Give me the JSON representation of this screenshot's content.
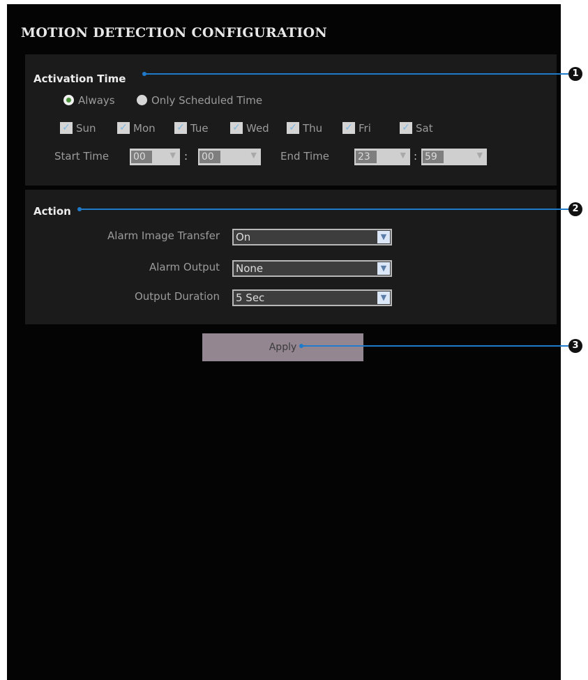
{
  "page_title": "MOTION DETECTION CONFIGURATION",
  "activation": {
    "title": "Activation Time",
    "radios": [
      {
        "label": "Always",
        "selected": true
      },
      {
        "label": "Only Scheduled Time",
        "selected": false
      }
    ],
    "days": [
      {
        "label": "Sun",
        "checked": true
      },
      {
        "label": "Mon",
        "checked": true
      },
      {
        "label": "Tue",
        "checked": true
      },
      {
        "label": "Wed",
        "checked": true
      },
      {
        "label": "Thu",
        "checked": true
      },
      {
        "label": "Fri",
        "checked": true
      },
      {
        "label": "Sat",
        "checked": true
      }
    ],
    "start_label": "Start Time",
    "start_hour": "00",
    "start_minute": "00",
    "end_label": "End Time",
    "end_hour": "23",
    "end_minute": "59",
    "separator": ":"
  },
  "action": {
    "title": "Action",
    "rows": [
      {
        "label": "Alarm Image Transfer",
        "value": "On"
      },
      {
        "label": "Alarm Output",
        "value": "None"
      },
      {
        "label": "Output Duration",
        "value": "5 Sec"
      }
    ]
  },
  "apply_label": "Apply",
  "callouts": [
    "1",
    "2",
    "3"
  ],
  "colors": {
    "panel_bg": "#040404",
    "section_bg": "#1b1b1b",
    "callout": "#1f7ac9",
    "apply_bg": "#938690"
  },
  "icons": {
    "checkmark": "check-icon",
    "dropdown": "chevron-down-icon"
  }
}
